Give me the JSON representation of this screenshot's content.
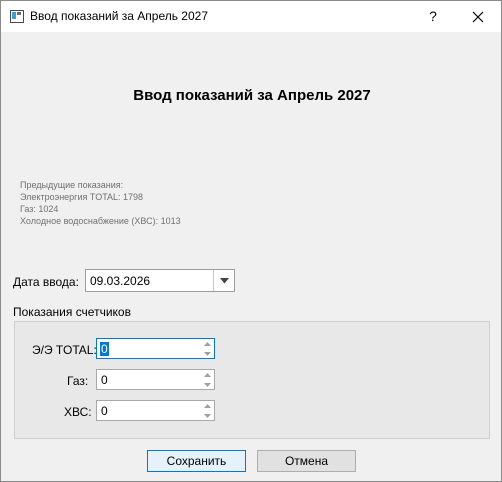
{
  "window": {
    "title": "Ввод показаний за Апрель 2027",
    "help_glyph": "?",
    "icons": [
      "app-icon",
      "help-icon",
      "close-icon"
    ]
  },
  "heading": "Ввод показаний за Апрель 2027",
  "previous": {
    "caption": "Предыдущие показания:",
    "lines": [
      "Электроэнергия TOTAL: 1798",
      "Газ: 1024",
      "Холодное водоснабжение (ХВС): 1013"
    ]
  },
  "date": {
    "label": "Дата ввода:",
    "value": "09.03.2026"
  },
  "meters": {
    "group_title": "Показания счетчиков",
    "fields": [
      {
        "label": "Э/Э TOTAL:",
        "value": "0"
      },
      {
        "label": "Газ:",
        "value": "0"
      },
      {
        "label": "ХВС:",
        "value": "0"
      }
    ]
  },
  "buttons": {
    "save": "Сохранить",
    "cancel": "Отмена"
  },
  "colors": {
    "accent": "#0078d7",
    "background": "#f0f0f0",
    "group_background": "#e8e8e8"
  }
}
